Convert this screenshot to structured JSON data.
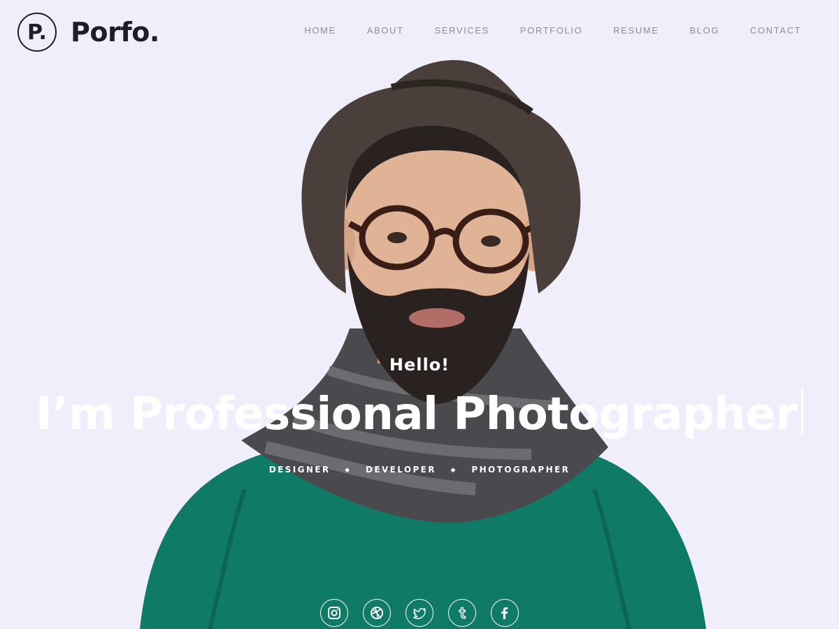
{
  "brand": {
    "mark": "P.",
    "name": "Porfo."
  },
  "nav": {
    "items": [
      "HOME",
      "ABOUT",
      "SERVICES",
      "PORTFOLIO",
      "RESUME",
      "BLOG",
      "CONTACT"
    ]
  },
  "hero": {
    "greeting": "Hello!",
    "headline": "I’m Professional Photographer",
    "roles": [
      "DESIGNER",
      "DEVELOPER",
      "PHOTOGRAPHER"
    ],
    "role_separator": "◆"
  },
  "social": {
    "icons": [
      "instagram-icon",
      "dribbble-icon",
      "twitter-icon",
      "tumblr-icon",
      "facebook-icon"
    ]
  },
  "colors": {
    "background": "#efeefa",
    "brand_text": "#1e1e2a",
    "nav_text": "#8d8c98",
    "hero_text": "#ffffff",
    "sweater": "#0f7a66",
    "scarf": "#4a4a4e",
    "hat": "#4a3f3a"
  }
}
